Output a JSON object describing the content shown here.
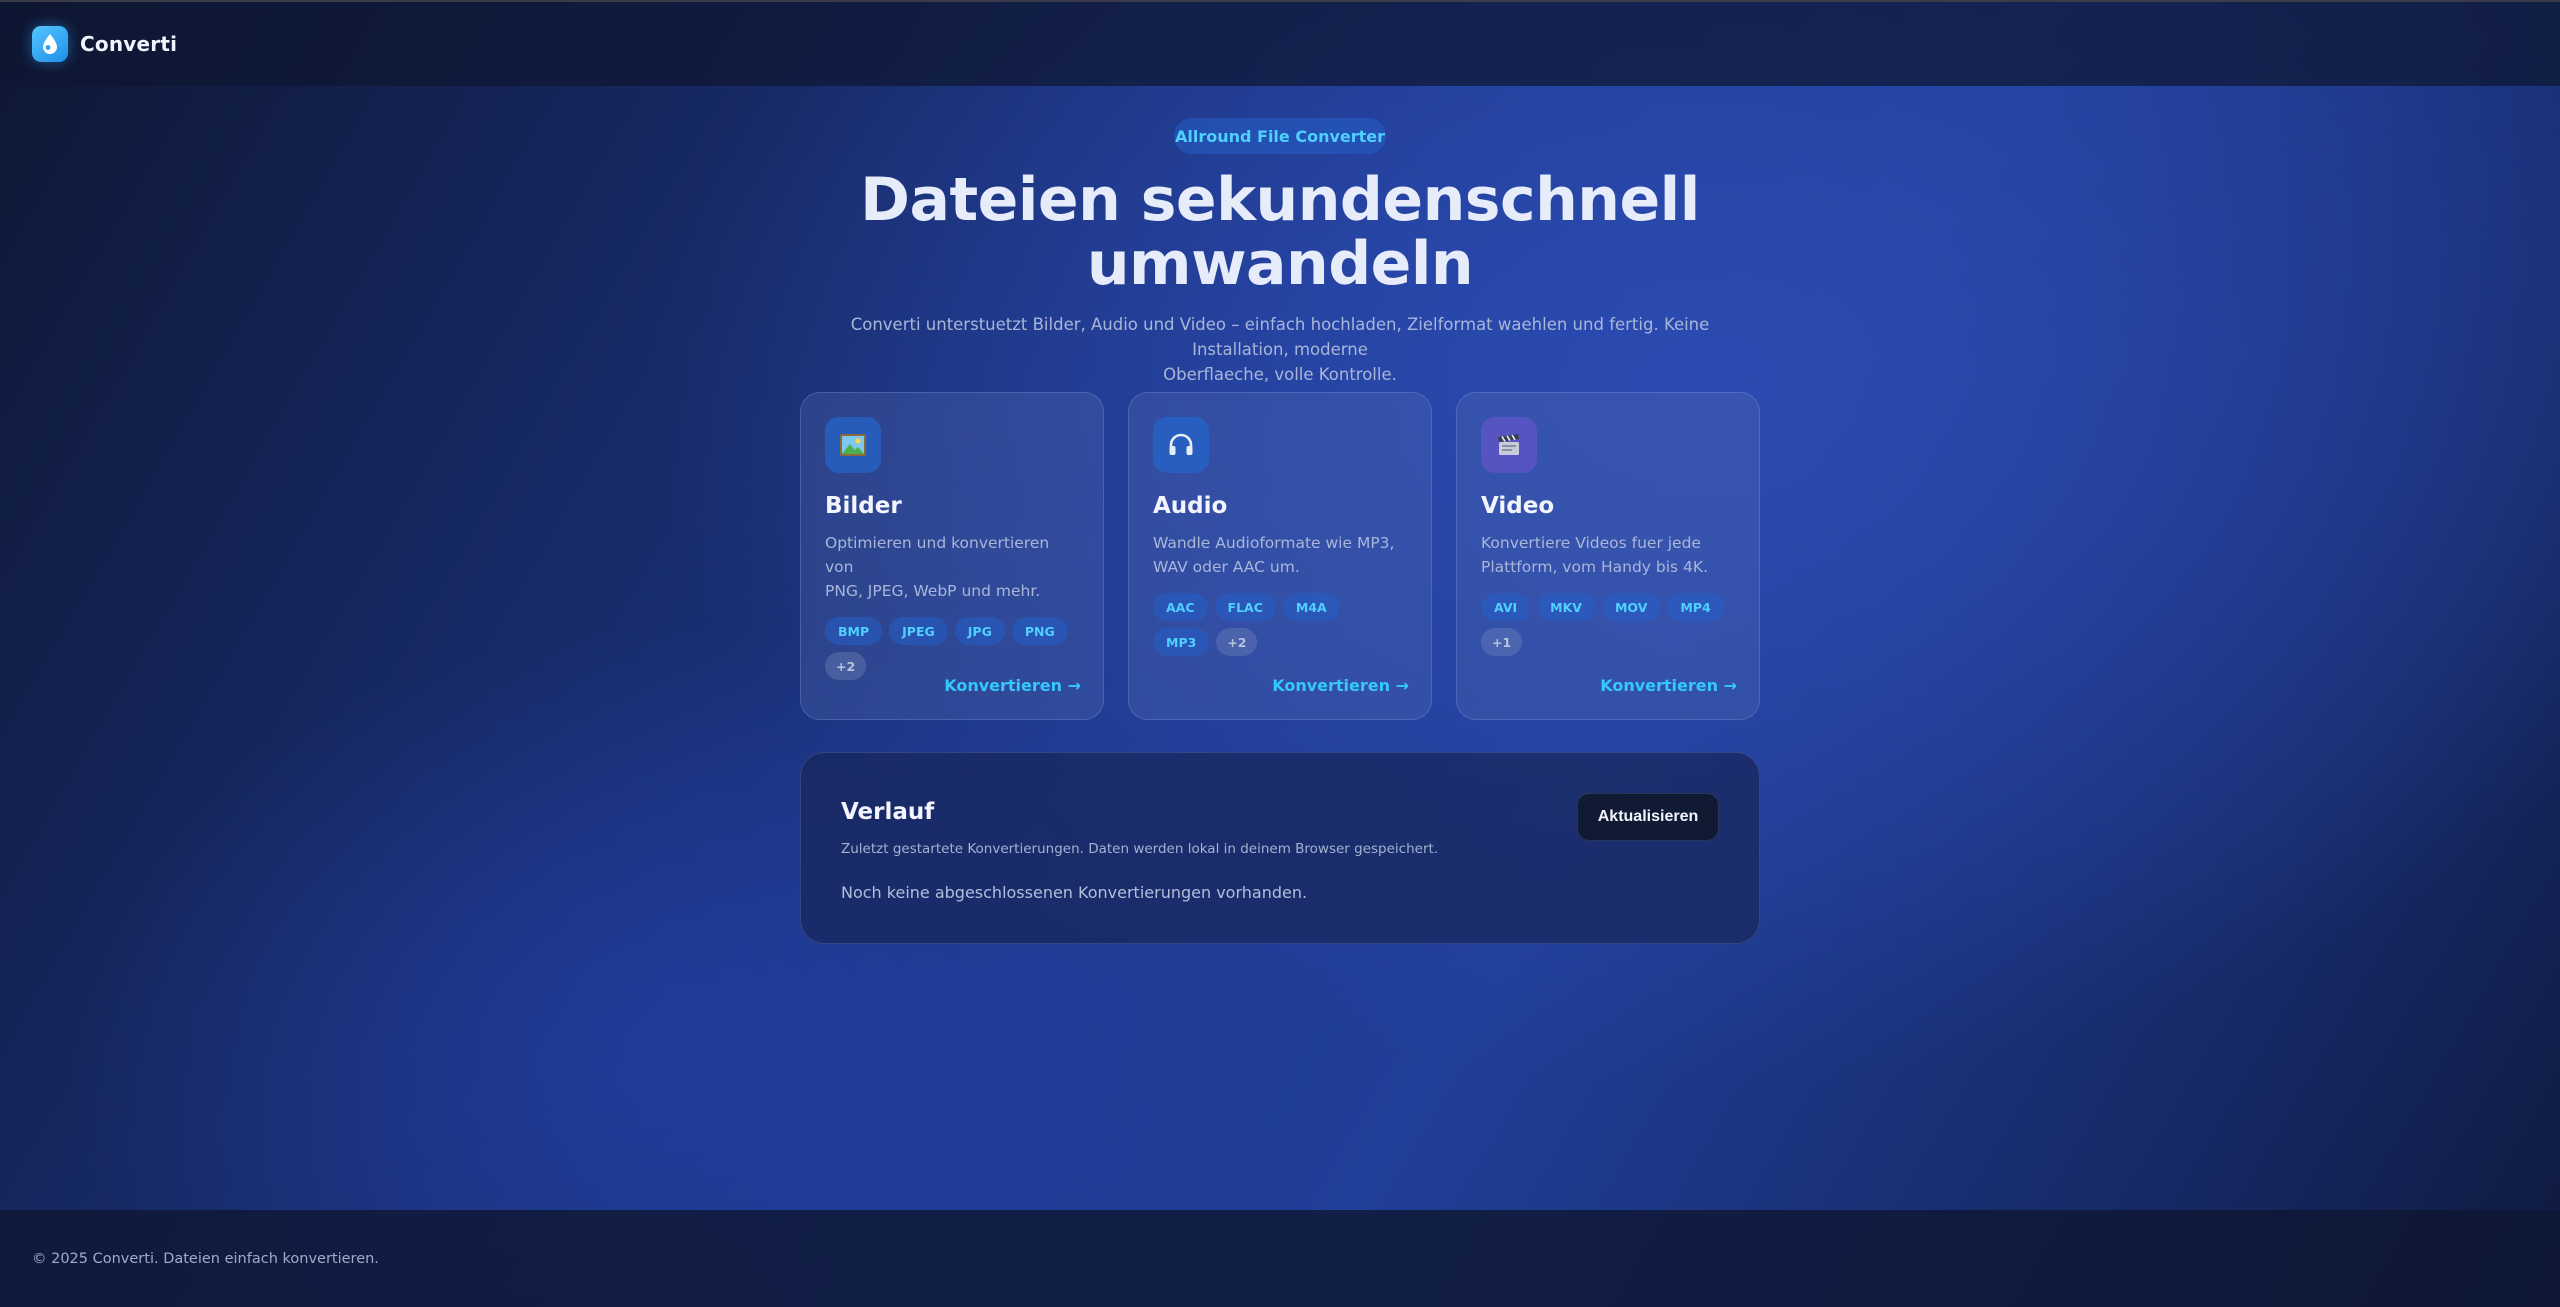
{
  "header": {
    "brand": "Converti",
    "logo_icon": "droplet-icon"
  },
  "hero": {
    "badge": "Allround File Converter",
    "title_line1": "Dateien sekundenschnell",
    "title_line2": "umwandeln",
    "subtitle_line1": "Converti unterstuetzt Bilder, Audio und Video – einfach hochladen, Zielformat waehlen und fertig. Keine Installation, moderne",
    "subtitle_line2": "Oberflaeche, volle Kontrolle."
  },
  "cards": [
    {
      "icon": "picture-icon",
      "title": "Bilder",
      "desc_line1": "Optimieren und konvertieren von",
      "desc_line2": "PNG, JPEG, WebP und mehr.",
      "tags": [
        "BMP",
        "JPEG",
        "JPG",
        "PNG"
      ],
      "more": "+2",
      "cta": "Konvertieren →"
    },
    {
      "icon": "headphones-icon",
      "title": "Audio",
      "desc_line1": "Wandle Audioformate wie MP3,",
      "desc_line2": "WAV oder AAC um.",
      "tags": [
        "AAC",
        "FLAC",
        "M4A",
        "MP3"
      ],
      "more": "+2",
      "cta": "Konvertieren →"
    },
    {
      "icon": "clapperboard-icon",
      "title": "Video",
      "desc_line1": "Konvertiere Videos fuer jede",
      "desc_line2": "Plattform, vom Handy bis 4K.",
      "tags": [
        "AVI",
        "MKV",
        "MOV",
        "MP4"
      ],
      "more": "+1",
      "cta": "Konvertieren →"
    }
  ],
  "history": {
    "title": "Verlauf",
    "subtitle": "Zuletzt gestartete Konvertierungen. Daten werden lokal in deinem Browser gespeichert.",
    "empty": "Noch keine abgeschlossenen Konvertierungen vorhanden.",
    "refresh_label": "Aktualisieren"
  },
  "footer": {
    "text": "© 2025 Converti. Dateien einfach konvertieren."
  },
  "colors": {
    "accent": "#34c8ff",
    "tag_text": "#4fd0ff",
    "background": "#1e3a8f",
    "button_dark": "#111a33"
  }
}
